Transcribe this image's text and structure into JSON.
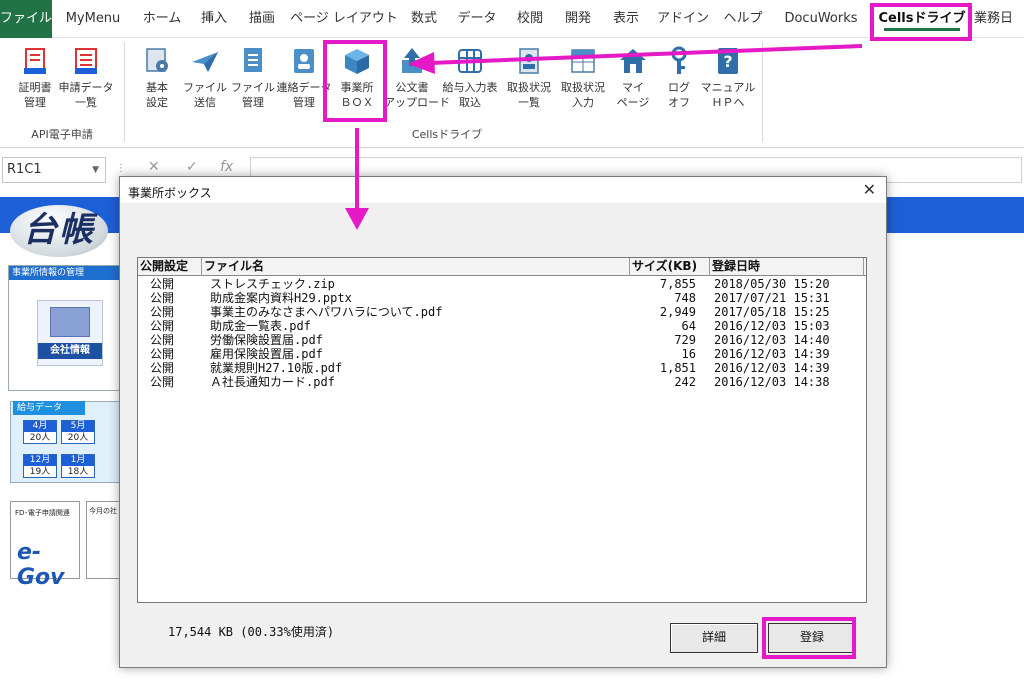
{
  "tabs": [
    "ファイル",
    "MyMenu",
    "ホーム",
    "挿入",
    "描画",
    "ページ レイアウト",
    "数式",
    "データ",
    "校閲",
    "開発",
    "表示",
    "アドイン",
    "ヘルプ",
    "DocuWorks",
    "Cellsドライブ",
    "業務日"
  ],
  "ribbon": {
    "api_group": {
      "label": "API電子申請",
      "buttons": [
        "証明書\n管理",
        "申請データ\n一覧"
      ]
    },
    "cells_group": {
      "label": "Cellsドライブ",
      "buttons": [
        "基本\n設定",
        "ファイル\n送信",
        "ファイル\n管理",
        "連絡データ\n管理",
        "事業所\nＢＯＸ",
        "公文書\nアップロード",
        "給与入力表\n取込",
        "取扱状況\n一覧",
        "取扱状況\n入力",
        "マイ\nページ",
        "ログ\nオフ",
        "マニュアル\nＨＰへ"
      ]
    }
  },
  "formula_bar": {
    "name_box": "R1C1",
    "cancel": "✕",
    "enter": "✓",
    "fx": "fx"
  },
  "sheet": {
    "logo": "台帳",
    "company_panel_title": "事業所情報の管理",
    "company_button": "会社情報",
    "pay_panel_title": "給与データ",
    "pay_cells": [
      {
        "month": "4月",
        "value": "20人"
      },
      {
        "month": "5月",
        "value": "20人"
      },
      {
        "month": "12月",
        "value": "19人"
      },
      {
        "month": "1月",
        "value": "18人"
      }
    ],
    "egov_panel_title": "FD･電子申請関連",
    "egov_logo": "e-Gov",
    "month_panel_title": "今月の社"
  },
  "dialog": {
    "title": "事業所ボックス",
    "close": "✕",
    "columns": [
      "公開設定",
      "ファイル名",
      "サイズ(KB)",
      "登録日時"
    ],
    "rows": [
      {
        "visibility": "公開",
        "name": "ストレスチェック.zip",
        "size": "7,855",
        "date": "2018/05/30 15:20"
      },
      {
        "visibility": "公開",
        "name": "助成金案内資料H29.pptx",
        "size": "748",
        "date": "2017/07/21 15:31"
      },
      {
        "visibility": "公開",
        "name": "事業主のみなさまへパワハラについて.pdf",
        "size": "2,949",
        "date": "2017/05/18 15:25"
      },
      {
        "visibility": "公開",
        "name": "助成金一覧表.pdf",
        "size": "64",
        "date": "2016/12/03 15:03"
      },
      {
        "visibility": "公開",
        "name": "労働保険設置届.pdf",
        "size": "729",
        "date": "2016/12/03 14:40"
      },
      {
        "visibility": "公開",
        "name": "雇用保険設置届.pdf",
        "size": "16",
        "date": "2016/12/03 14:39"
      },
      {
        "visibility": "公開",
        "name": "就業規則H27.10版.pdf",
        "size": "1,851",
        "date": "2016/12/03 14:39"
      },
      {
        "visibility": "公開",
        "name": "Ａ社長通知カード.pdf",
        "size": "242",
        "date": "2016/12/03 14:38"
      }
    ],
    "usage": "17,544 KB (00.33%使用済)",
    "detail_button": "詳細",
    "register_button": "登録"
  },
  "colors": {
    "excel_green": "#217346",
    "callout_magenta": "#e619c7",
    "sheet_blue": "#1d5fd6"
  }
}
